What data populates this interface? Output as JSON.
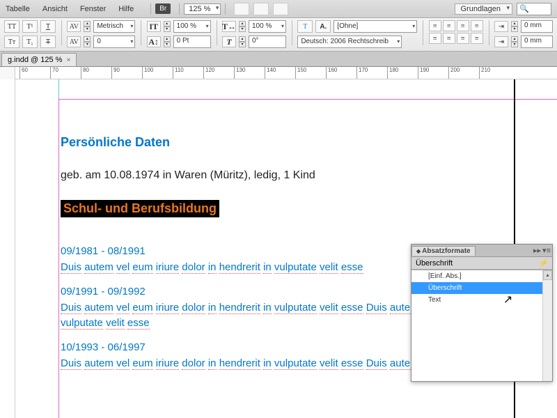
{
  "menubar": {
    "items": [
      "Tabelle",
      "Ansicht",
      "Fenster",
      "Hilfe"
    ],
    "br": "Br",
    "zoom": "125 %",
    "workspace": "Grundlagen"
  },
  "controlbar": {
    "metricLabel": "Metrisch",
    "kerning": "0",
    "scaleX": "100 %",
    "scaleY": "100 %",
    "baseline": "0 Pt",
    "skew": "0°",
    "styleNone": "[Ohne]",
    "langLabel": "Deutsch: 2006 Rechtschreib",
    "indent": "0 mm",
    "indent2": "0 mm"
  },
  "tab": {
    "label": "g.indd @ 125 %"
  },
  "ruler": {
    "marks": [
      60,
      70,
      80,
      90,
      100,
      110,
      120,
      130,
      140,
      150,
      160,
      170,
      180,
      190,
      200,
      210
    ]
  },
  "doc": {
    "h1": "Persönliche Daten",
    "line1": "geb. am 10.08.1974 in Waren (Müritz), ledig, 1 Kind",
    "h2_sel": "Schul- und Berufsbildung",
    "blocks": [
      {
        "date": "09/1981 - 08/1991",
        "text": "Duis autem vel eum iriure dolor in hendrerit in vulputate velit esse"
      },
      {
        "date": "09/1991 - 09/1992",
        "text": "Duis autem vel eum iriure dolor in hendrerit in vulputate velit esse Duis autem iriure dolor in hendrerit in vulputate velit esse"
      },
      {
        "date": "10/1993 - 06/1997",
        "text": "Duis autem vel eum iriure dolor in hendrerit in vulputate velit esse Duis autem"
      }
    ]
  },
  "panel": {
    "title": "Absatzformate",
    "current": "Überschrift",
    "items": [
      "[Einf. Abs.]",
      "Überschrift",
      "Text"
    ],
    "selectedIndex": 1
  }
}
